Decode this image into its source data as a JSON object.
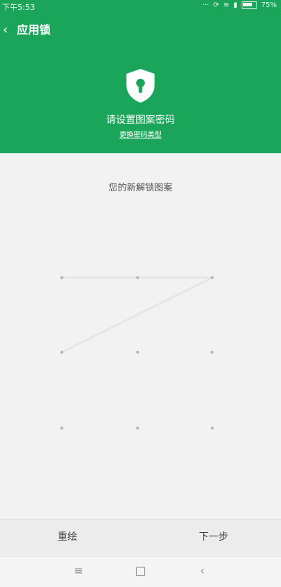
{
  "status_bar": {
    "time": "下午5:53",
    "battery": "75%"
  },
  "header": {
    "title": "应用锁",
    "setup_title": "请设置图案密码",
    "change_link": "更换密码类型",
    "color": "#1ba55a"
  },
  "body": {
    "prompt": "您的新解锁图案",
    "pattern_drawn": [
      [
        0,
        0
      ],
      [
        0,
        1
      ],
      [
        0,
        2
      ],
      [
        1,
        0
      ]
    ]
  },
  "actions": {
    "redraw_label": "重绘",
    "next_label": "下一步"
  },
  "nav_bar": {
    "menu_icon": "≡",
    "home_icon": "□",
    "back_icon": "‹"
  }
}
